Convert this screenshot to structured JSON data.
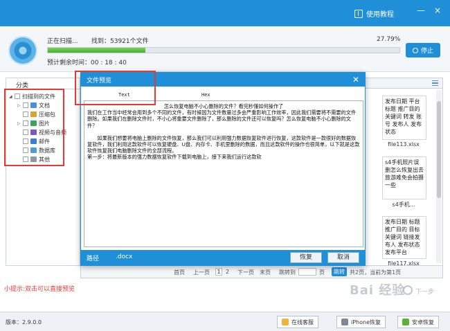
{
  "titlebar": {
    "help_label": "使用教程",
    "min": "—",
    "close": "×"
  },
  "scan": {
    "status": "正在扫描...",
    "found": "找到：53921个文件",
    "percent_text": "27.79%",
    "progress": 0.2779,
    "remaining": "预计剩余时间：00 : 18 : 40",
    "stop_label": "停止"
  },
  "category": {
    "tab_label": "分类",
    "root": "扫描到的文件",
    "items": [
      "文档",
      "压缩包",
      "图片",
      "视频与音频",
      "邮件",
      "数据库",
      "其他"
    ],
    "colors": [
      "#4a8fd6",
      "#d9a42b",
      "#3aa35c",
      "#7a58c8",
      "#3b7fd0",
      "#4f9bd9",
      "#8a9aa8"
    ]
  },
  "list": {
    "cards": [
      {
        "text": "发布日期 平台标题 推广目的 关键词 转发 账号 发布人 发布状态",
        "name": "file113.xlsx"
      },
      {
        "text": "s4手机照片误删怎么恢复出去旅游难免会拍摄一些",
        "name": "s4手机..."
      },
      {
        "text": "发布日期 标题推广目的 目标关键词 链接发布人 发布状态 发布平台",
        "name": "file117.xlsx"
      }
    ]
  },
  "pager": {
    "first": "首页",
    "prev": "上一页",
    "p1": "1",
    "p2": "2",
    "next": "下一页",
    "last": "末页",
    "jump_to": "跳转到",
    "page_unit": "页",
    "jump_btn": "跳转",
    "summary": "共2页，当前为第1页"
  },
  "tip": "小提示:双击可以直接预览",
  "dialog": {
    "title": "文件预览",
    "tab_text": "Text",
    "tab_hex": "Hex",
    "lines": [
      "怎么恢复电脑不小心删除的文件？看完秒懂如何操作了",
      "我们在工作当中经常会用到多个不同的文件，有时候因为文件数量过多会严重影响工作效率，因此我们需要将不需要的文件删除。如果我们在删除文件时，不小心将重要文件删除了，那么删除的文件还可以恢复吗？怎么恢复电脑不小心删除的文件？",
      "",
      "如果我们想要将电脑上删除的文件恢复，那么我们可以利用强力数据恢复软件进行恢复，这款软件是一款很好的数据恢复软件，我们利用这款软件可以恢复硬盘、U盘、内存卡、手机里删除的数据，而且这款软件的操作也很简单，以下就是这款软件恢复我们电脑删除文件的全部流程。",
      "第一步：将最新版本的强力数据恢复软件下载到电脑上，接下来我们运行这款软"
    ],
    "path_label": "路径",
    "path_value": ".docx",
    "restore_label": "恢复",
    "cancel_label": "取消"
  },
  "footer": {
    "version": "版本：2.9.0.0",
    "online": "在线客服",
    "iphone": "iPhone恢复",
    "android": "安卓恢复"
  },
  "watermark": {
    "text": "Bai 经验",
    "sub": "下一步"
  },
  "colors": {
    "accent": "#1f8fd8",
    "progress": "#43b02c",
    "highlight": "#e53935"
  }
}
